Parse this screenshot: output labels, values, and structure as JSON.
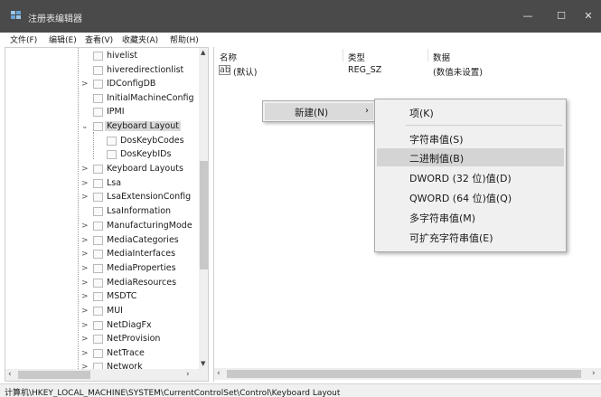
{
  "window": {
    "title": "注册表编辑器",
    "icon": "registry-icon",
    "minimize": "—",
    "maximize": "☐",
    "close": "✕"
  },
  "menu": [
    "文件(F)",
    "编辑(E)",
    "查看(V)",
    "收藏夹(A)",
    "帮助(H)"
  ],
  "tree": {
    "items": [
      {
        "label": "hivelist",
        "expandable": false
      },
      {
        "label": "hiveredirectionlist",
        "expandable": false
      },
      {
        "label": "IDConfigDB",
        "expandable": true
      },
      {
        "label": "InitialMachineConfig",
        "expandable": false
      },
      {
        "label": "IPMI",
        "expandable": false
      },
      {
        "label": "Keyboard Layout",
        "expandable": true,
        "expanded": true,
        "selected": true
      },
      {
        "label": "DosKeybCodes",
        "expandable": false,
        "child": true
      },
      {
        "label": "DosKeybIDs",
        "expandable": false,
        "child": true
      },
      {
        "label": "Keyboard Layouts",
        "expandable": true
      },
      {
        "label": "Lsa",
        "expandable": true
      },
      {
        "label": "LsaExtensionConfig",
        "expandable": true
      },
      {
        "label": "LsaInformation",
        "expandable": false
      },
      {
        "label": "ManufacturingMode",
        "expandable": true
      },
      {
        "label": "MediaCategories",
        "expandable": true
      },
      {
        "label": "MediaInterfaces",
        "expandable": true
      },
      {
        "label": "MediaProperties",
        "expandable": true
      },
      {
        "label": "MediaResources",
        "expandable": true
      },
      {
        "label": "MSDTC",
        "expandable": true
      },
      {
        "label": "MUI",
        "expandable": true
      },
      {
        "label": "NetDiagFx",
        "expandable": true
      },
      {
        "label": "NetProvision",
        "expandable": true
      },
      {
        "label": "NetTrace",
        "expandable": true
      },
      {
        "label": "Network",
        "expandable": true
      }
    ]
  },
  "values": {
    "columns": {
      "name": "名称",
      "type": "类型",
      "data": "数据"
    },
    "rows": [
      {
        "icon": "ab",
        "name": "(默认)",
        "type": "REG_SZ",
        "data": "(数值未设置)"
      }
    ]
  },
  "context_menu": {
    "new_label": "新建(N)",
    "arrow": "›"
  },
  "submenu": {
    "items": [
      "项(K)",
      "字符串值(S)",
      "二进制值(B)",
      "DWORD (32 位)值(D)",
      "QWORD (64 位)值(Q)",
      "多字符串值(M)",
      "可扩充字符串值(E)"
    ],
    "highlighted_index": 2
  },
  "status": {
    "path": "计算机\\HKEY_LOCAL_MACHINE\\SYSTEM\\CurrentControlSet\\Control\\Keyboard Layout"
  },
  "colors": {
    "titlebar": "#4a4a4a",
    "menu_bg": "#f0f0f0",
    "highlight": "#d4d4d4",
    "selected": "#d9d9d9"
  }
}
